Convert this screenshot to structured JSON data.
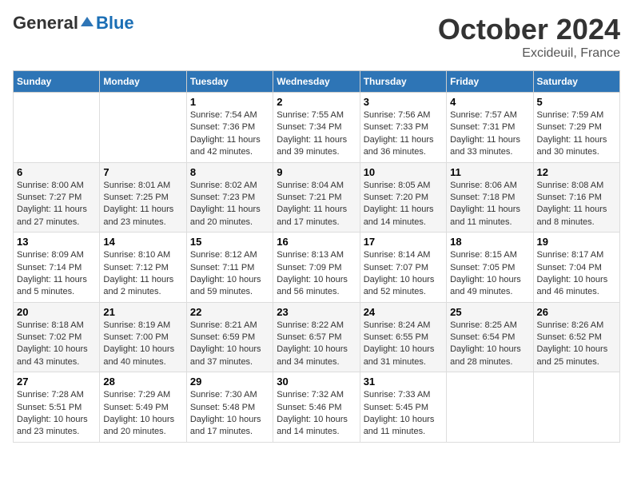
{
  "header": {
    "logo_general": "General",
    "logo_blue": "Blue",
    "month": "October 2024",
    "location": "Excideuil, France"
  },
  "weekdays": [
    "Sunday",
    "Monday",
    "Tuesday",
    "Wednesday",
    "Thursday",
    "Friday",
    "Saturday"
  ],
  "weeks": [
    [
      {
        "day": "",
        "sunrise": "",
        "sunset": "",
        "daylight": ""
      },
      {
        "day": "",
        "sunrise": "",
        "sunset": "",
        "daylight": ""
      },
      {
        "day": "1",
        "sunrise": "Sunrise: 7:54 AM",
        "sunset": "Sunset: 7:36 PM",
        "daylight": "Daylight: 11 hours and 42 minutes."
      },
      {
        "day": "2",
        "sunrise": "Sunrise: 7:55 AM",
        "sunset": "Sunset: 7:34 PM",
        "daylight": "Daylight: 11 hours and 39 minutes."
      },
      {
        "day": "3",
        "sunrise": "Sunrise: 7:56 AM",
        "sunset": "Sunset: 7:33 PM",
        "daylight": "Daylight: 11 hours and 36 minutes."
      },
      {
        "day": "4",
        "sunrise": "Sunrise: 7:57 AM",
        "sunset": "Sunset: 7:31 PM",
        "daylight": "Daylight: 11 hours and 33 minutes."
      },
      {
        "day": "5",
        "sunrise": "Sunrise: 7:59 AM",
        "sunset": "Sunset: 7:29 PM",
        "daylight": "Daylight: 11 hours and 30 minutes."
      }
    ],
    [
      {
        "day": "6",
        "sunrise": "Sunrise: 8:00 AM",
        "sunset": "Sunset: 7:27 PM",
        "daylight": "Daylight: 11 hours and 27 minutes."
      },
      {
        "day": "7",
        "sunrise": "Sunrise: 8:01 AM",
        "sunset": "Sunset: 7:25 PM",
        "daylight": "Daylight: 11 hours and 23 minutes."
      },
      {
        "day": "8",
        "sunrise": "Sunrise: 8:02 AM",
        "sunset": "Sunset: 7:23 PM",
        "daylight": "Daylight: 11 hours and 20 minutes."
      },
      {
        "day": "9",
        "sunrise": "Sunrise: 8:04 AM",
        "sunset": "Sunset: 7:21 PM",
        "daylight": "Daylight: 11 hours and 17 minutes."
      },
      {
        "day": "10",
        "sunrise": "Sunrise: 8:05 AM",
        "sunset": "Sunset: 7:20 PM",
        "daylight": "Daylight: 11 hours and 14 minutes."
      },
      {
        "day": "11",
        "sunrise": "Sunrise: 8:06 AM",
        "sunset": "Sunset: 7:18 PM",
        "daylight": "Daylight: 11 hours and 11 minutes."
      },
      {
        "day": "12",
        "sunrise": "Sunrise: 8:08 AM",
        "sunset": "Sunset: 7:16 PM",
        "daylight": "Daylight: 11 hours and 8 minutes."
      }
    ],
    [
      {
        "day": "13",
        "sunrise": "Sunrise: 8:09 AM",
        "sunset": "Sunset: 7:14 PM",
        "daylight": "Daylight: 11 hours and 5 minutes."
      },
      {
        "day": "14",
        "sunrise": "Sunrise: 8:10 AM",
        "sunset": "Sunset: 7:12 PM",
        "daylight": "Daylight: 11 hours and 2 minutes."
      },
      {
        "day": "15",
        "sunrise": "Sunrise: 8:12 AM",
        "sunset": "Sunset: 7:11 PM",
        "daylight": "Daylight: 10 hours and 59 minutes."
      },
      {
        "day": "16",
        "sunrise": "Sunrise: 8:13 AM",
        "sunset": "Sunset: 7:09 PM",
        "daylight": "Daylight: 10 hours and 56 minutes."
      },
      {
        "day": "17",
        "sunrise": "Sunrise: 8:14 AM",
        "sunset": "Sunset: 7:07 PM",
        "daylight": "Daylight: 10 hours and 52 minutes."
      },
      {
        "day": "18",
        "sunrise": "Sunrise: 8:15 AM",
        "sunset": "Sunset: 7:05 PM",
        "daylight": "Daylight: 10 hours and 49 minutes."
      },
      {
        "day": "19",
        "sunrise": "Sunrise: 8:17 AM",
        "sunset": "Sunset: 7:04 PM",
        "daylight": "Daylight: 10 hours and 46 minutes."
      }
    ],
    [
      {
        "day": "20",
        "sunrise": "Sunrise: 8:18 AM",
        "sunset": "Sunset: 7:02 PM",
        "daylight": "Daylight: 10 hours and 43 minutes."
      },
      {
        "day": "21",
        "sunrise": "Sunrise: 8:19 AM",
        "sunset": "Sunset: 7:00 PM",
        "daylight": "Daylight: 10 hours and 40 minutes."
      },
      {
        "day": "22",
        "sunrise": "Sunrise: 8:21 AM",
        "sunset": "Sunset: 6:59 PM",
        "daylight": "Daylight: 10 hours and 37 minutes."
      },
      {
        "day": "23",
        "sunrise": "Sunrise: 8:22 AM",
        "sunset": "Sunset: 6:57 PM",
        "daylight": "Daylight: 10 hours and 34 minutes."
      },
      {
        "day": "24",
        "sunrise": "Sunrise: 8:24 AM",
        "sunset": "Sunset: 6:55 PM",
        "daylight": "Daylight: 10 hours and 31 minutes."
      },
      {
        "day": "25",
        "sunrise": "Sunrise: 8:25 AM",
        "sunset": "Sunset: 6:54 PM",
        "daylight": "Daylight: 10 hours and 28 minutes."
      },
      {
        "day": "26",
        "sunrise": "Sunrise: 8:26 AM",
        "sunset": "Sunset: 6:52 PM",
        "daylight": "Daylight: 10 hours and 25 minutes."
      }
    ],
    [
      {
        "day": "27",
        "sunrise": "Sunrise: 7:28 AM",
        "sunset": "Sunset: 5:51 PM",
        "daylight": "Daylight: 10 hours and 23 minutes."
      },
      {
        "day": "28",
        "sunrise": "Sunrise: 7:29 AM",
        "sunset": "Sunset: 5:49 PM",
        "daylight": "Daylight: 10 hours and 20 minutes."
      },
      {
        "day": "29",
        "sunrise": "Sunrise: 7:30 AM",
        "sunset": "Sunset: 5:48 PM",
        "daylight": "Daylight: 10 hours and 17 minutes."
      },
      {
        "day": "30",
        "sunrise": "Sunrise: 7:32 AM",
        "sunset": "Sunset: 5:46 PM",
        "daylight": "Daylight: 10 hours and 14 minutes."
      },
      {
        "day": "31",
        "sunrise": "Sunrise: 7:33 AM",
        "sunset": "Sunset: 5:45 PM",
        "daylight": "Daylight: 10 hours and 11 minutes."
      },
      {
        "day": "",
        "sunrise": "",
        "sunset": "",
        "daylight": ""
      },
      {
        "day": "",
        "sunrise": "",
        "sunset": "",
        "daylight": ""
      }
    ]
  ]
}
